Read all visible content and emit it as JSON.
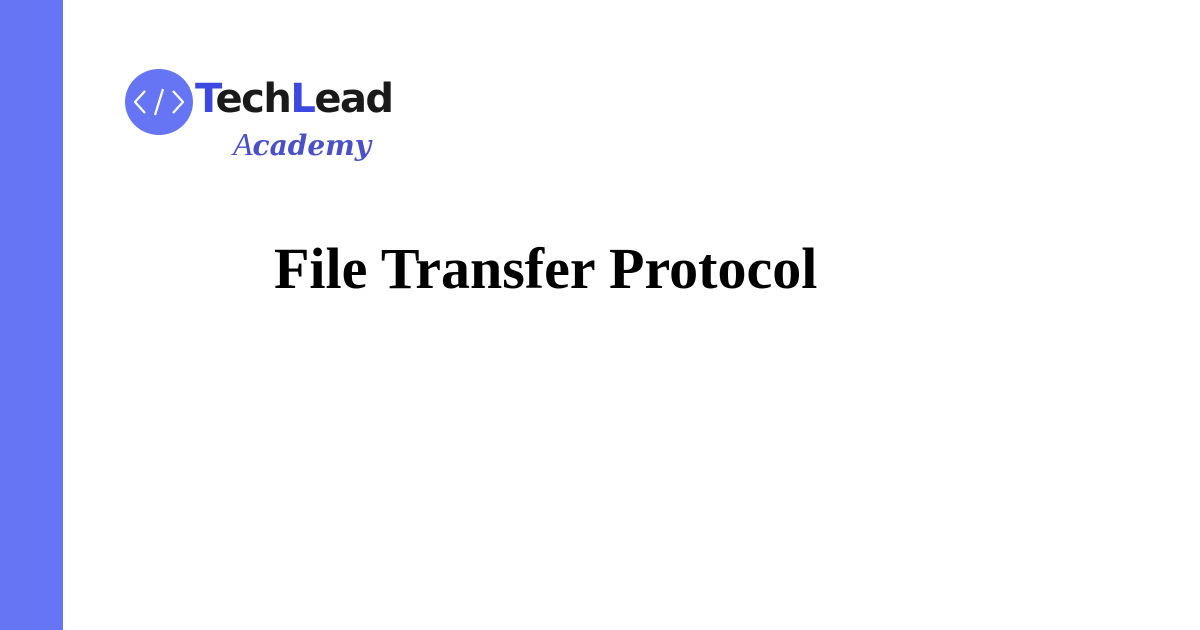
{
  "colors": {
    "side_bar": "#6675f3",
    "logo_badge": "#6675f3",
    "logo_accent": "#3d48e0",
    "logo_text": "#1a1a1a",
    "academy_text": "#4a50c8"
  },
  "logo": {
    "badge_icon": "code-brackets-icon",
    "badge_symbol": "</>",
    "word_part1": "T",
    "word_part2": "ech",
    "word_part3": "L",
    "word_part4": "ead",
    "academy_first": "A",
    "academy_rest": "cademy"
  },
  "headline": {
    "text": "File Transfer Protocol"
  }
}
